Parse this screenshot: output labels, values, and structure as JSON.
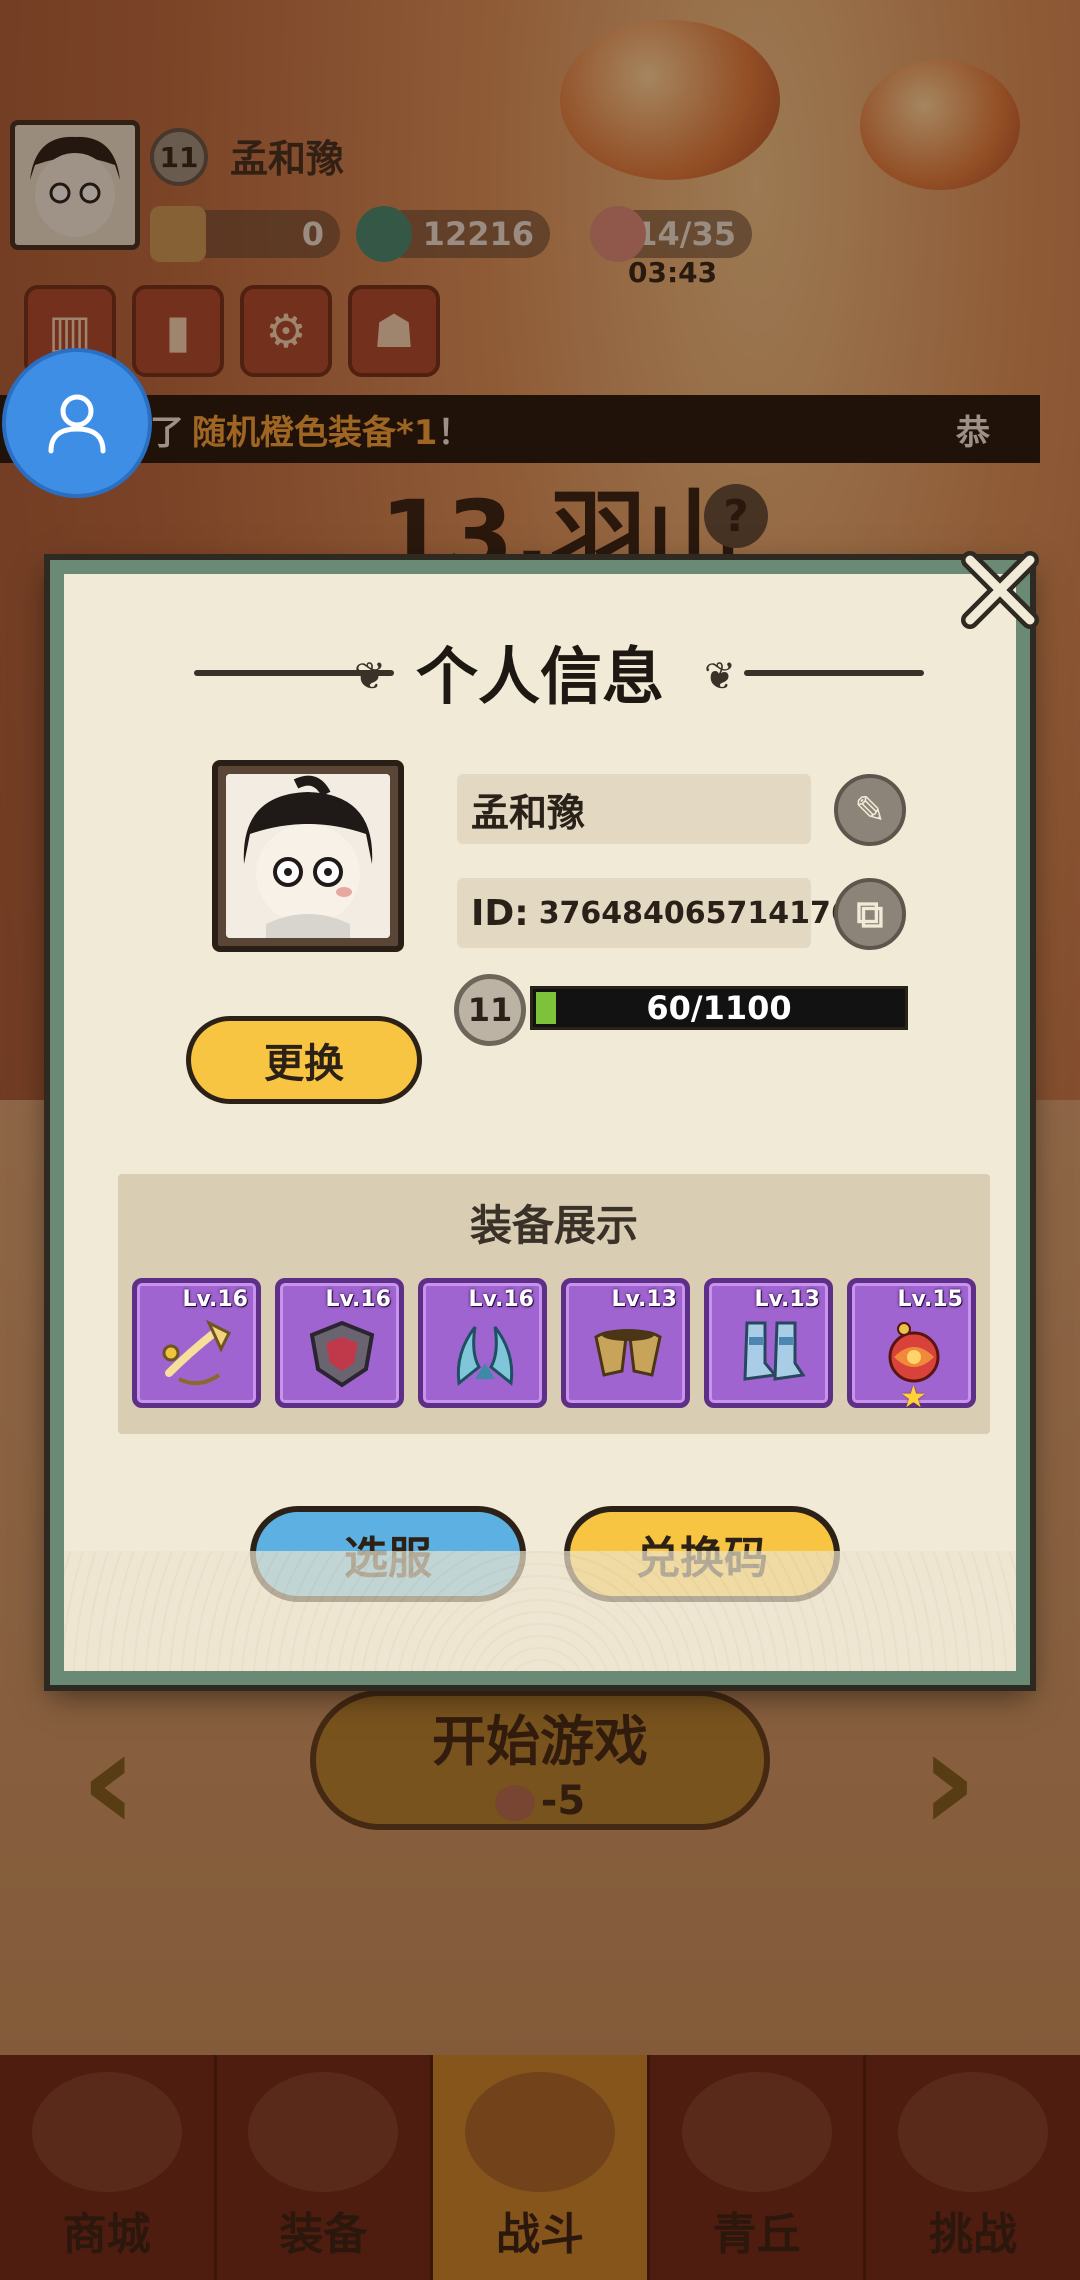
{
  "hud": {
    "player_name": "孟和豫",
    "level": "11",
    "currency_a": "0",
    "currency_b": "12216",
    "stamina": "14/35",
    "stamina_timer": "03:43"
  },
  "notice": {
    "prefix": "了",
    "highlight": "随机橙色装备*1",
    "suffix": "！",
    "right_text": "恭"
  },
  "stage": {
    "title": "13.羽山",
    "help": "?"
  },
  "start_game": {
    "label": "开始游戏",
    "cost": "-5"
  },
  "modal": {
    "title": "个人信息",
    "change_label": "更换",
    "player_name": "孟和豫",
    "id_label": "ID:",
    "id_value": "376484065714176",
    "level": "11",
    "xp_text": "60/1100",
    "xp_fraction": 0.0545,
    "equip_title": "装备展示",
    "equipment": [
      {
        "level": "Lv.16",
        "icon": "necklace-icon"
      },
      {
        "level": "Lv.16",
        "icon": "armor-icon"
      },
      {
        "level": "Lv.16",
        "icon": "claw-icon"
      },
      {
        "level": "Lv.13",
        "icon": "gloves-icon"
      },
      {
        "level": "Lv.13",
        "icon": "boots-icon"
      },
      {
        "level": "Lv.15",
        "icon": "orb-icon",
        "star": "★"
      }
    ],
    "server_label": "选服",
    "code_label": "兑换码"
  },
  "nav": {
    "items": [
      {
        "label": "商城"
      },
      {
        "label": "装备"
      },
      {
        "label": "战斗"
      },
      {
        "label": "青丘"
      },
      {
        "label": "挑战"
      }
    ],
    "active_index": 2
  },
  "colors": {
    "modal_border": "#6a8a76",
    "accent_yellow": "#f7c542",
    "accent_blue": "#5db1e2",
    "equip_purple": "#a064d0",
    "notice_highlight": "#f3a336"
  }
}
